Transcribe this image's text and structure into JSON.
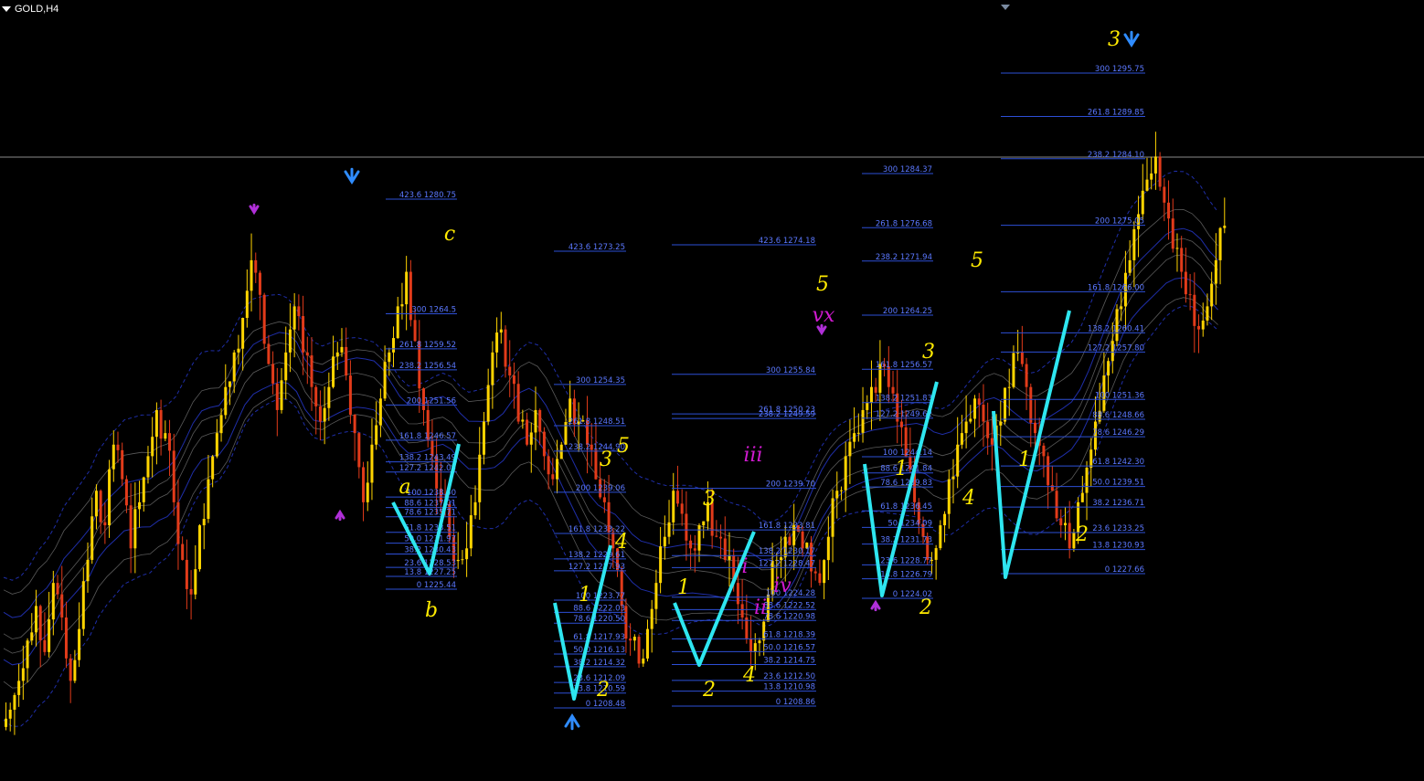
{
  "window": {
    "symbol_title": "GOLD,H4"
  },
  "colors": {
    "background": "#000000",
    "bull_candle": "#ffd400",
    "bear_candle": "#e23b1a",
    "fib_line": "#2d4fd6",
    "fib_text": "#5b78ff",
    "wave_yellow": "#ffea00",
    "wave_magenta": "#d01ad0",
    "pattern_cyan": "#2ee6f0",
    "arrow_blue": "#2f8cff",
    "arrow_purple": "#b02fd8",
    "band_blue": "#1f2ea8",
    "band_gray": "#5a5a5a",
    "hline": "#8a8a8a"
  },
  "chart_data": {
    "type": "candlestick",
    "title": "GOLD,H4",
    "xlabel": "",
    "ylabel": "",
    "grid": false,
    "price_range": [
      1190,
      1320
    ],
    "candles_close_path": [
      1200,
      1205,
      1212,
      1218,
      1210,
      1222,
      1216,
      1205,
      1214,
      1226,
      1238,
      1232,
      1246,
      1240,
      1228,
      1236,
      1244,
      1252,
      1248,
      1236,
      1226,
      1220,
      1232,
      1240,
      1248,
      1256,
      1262,
      1268,
      1278,
      1272,
      1260,
      1252,
      1262,
      1270,
      1262,
      1256,
      1250,
      1256,
      1262,
      1258,
      1248,
      1236,
      1246,
      1254,
      1262,
      1270,
      1276,
      1264,
      1252,
      1244,
      1236,
      1230,
      1226,
      1228,
      1236,
      1250,
      1262,
      1266,
      1258,
      1250,
      1246,
      1252,
      1244,
      1240,
      1246,
      1254,
      1250,
      1246,
      1240,
      1236,
      1228,
      1218,
      1212,
      1208,
      1214,
      1222,
      1230,
      1238,
      1234,
      1228,
      1232,
      1236,
      1230,
      1226,
      1222,
      1216,
      1210,
      1212,
      1220,
      1226,
      1230,
      1232,
      1228,
      1224,
      1222,
      1230,
      1238,
      1244,
      1248,
      1252,
      1256,
      1260,
      1256,
      1250,
      1244,
      1236,
      1230,
      1226,
      1232,
      1240,
      1246,
      1250,
      1254,
      1250,
      1246,
      1250,
      1256,
      1262,
      1256,
      1248,
      1244,
      1238,
      1232,
      1228,
      1236,
      1242,
      1250,
      1258,
      1264,
      1270,
      1278,
      1286,
      1292,
      1296,
      1288,
      1280,
      1276,
      1272,
      1266,
      1270,
      1278,
      1284
    ],
    "fib_sets": [
      {
        "levels": [
          [
            "423.6",
            "1280.75"
          ],
          [
            "300",
            "1264.5"
          ],
          [
            "261.8",
            "1259.52"
          ],
          [
            "238.2",
            "1256.54"
          ],
          [
            "200",
            "1251.56"
          ],
          [
            "161.8",
            "1246.57"
          ],
          [
            "138.2",
            "1243.49"
          ],
          [
            "127.2",
            "1242.05"
          ],
          [
            "100",
            "1238.50"
          ],
          [
            "88.6",
            "1237.01"
          ],
          [
            "78.6",
            "1235.71"
          ],
          [
            "61.8",
            "1233.51"
          ],
          [
            "50.0",
            "1231.97"
          ],
          [
            "38.2",
            "1230.43"
          ],
          [
            "23.6",
            "1228.53"
          ],
          [
            "13.8",
            "1227.25"
          ],
          [
            "0",
            "1225.44"
          ]
        ]
      },
      {
        "levels": [
          [
            "423.6",
            "1273.25"
          ],
          [
            "300",
            "1254.35"
          ],
          [
            "261.8",
            "1248.51"
          ],
          [
            "238.2",
            "1244.90"
          ],
          [
            "200",
            "1239.06"
          ],
          [
            "161.8",
            "1233.22"
          ],
          [
            "138.2",
            "1229.61"
          ],
          [
            "127.2",
            "1227.93"
          ],
          [
            "100",
            "1223.77"
          ],
          [
            "88.6",
            "1222.03"
          ],
          [
            "78.6",
            "1220.50"
          ],
          [
            "61.8",
            "1217.93"
          ],
          [
            "50.0",
            "1216.13"
          ],
          [
            "38.2",
            "1214.32"
          ],
          [
            "23.6",
            "1212.09"
          ],
          [
            "13.8",
            "1210.59"
          ],
          [
            "0",
            "1208.48"
          ]
        ]
      },
      {
        "levels": [
          [
            "423.6",
            "1274.18"
          ],
          [
            "300",
            "1255.84"
          ],
          [
            "261.8",
            "1250.23"
          ],
          [
            "238.2",
            "1249.59"
          ],
          [
            "200",
            "1239.70"
          ],
          [
            "161.8",
            "1233.81"
          ],
          [
            "138.2",
            "1230.17"
          ],
          [
            "127.2",
            "1228.47"
          ],
          [
            "100",
            "1224.28"
          ],
          [
            "88.6",
            "1222.52"
          ],
          [
            "78.6",
            "1220.98"
          ],
          [
            "61.8",
            "1218.39"
          ],
          [
            "50.0",
            "1216.57"
          ],
          [
            "38.2",
            "1214.75"
          ],
          [
            "23.6",
            "1212.50"
          ],
          [
            "13.8",
            "1210.98"
          ],
          [
            "0",
            "1208.86"
          ]
        ]
      },
      {
        "levels": [
          [
            "300",
            "1284.37"
          ],
          [
            "261.8",
            "1276.68"
          ],
          [
            "238.2",
            "1271.94"
          ],
          [
            "200",
            "1264.25"
          ],
          [
            "161.8",
            "1256.57"
          ],
          [
            "138.2",
            "1251.83"
          ],
          [
            "127.2",
            "1249.62"
          ],
          [
            "100",
            "1244.14"
          ],
          [
            "88.6",
            "1241.84"
          ],
          [
            "78.6",
            "1239.83"
          ],
          [
            "61.8",
            "1236.45"
          ],
          [
            "50",
            "1234.09"
          ],
          [
            "38.2",
            "1231.73"
          ],
          [
            "23.6",
            "1228.77"
          ],
          [
            "13.8",
            "1226.79"
          ],
          [
            "0",
            "1224.02"
          ]
        ]
      },
      {
        "levels": [
          [
            "300",
            "1295.75"
          ],
          [
            "261.8",
            "1289.85"
          ],
          [
            "238.2",
            "1284.10"
          ],
          [
            "200",
            "1275.05"
          ],
          [
            "161.8",
            "1266.00"
          ],
          [
            "138.2",
            "1260.41"
          ],
          [
            "127.2",
            "1257.80"
          ],
          [
            "100",
            "1251.36"
          ],
          [
            "88.6",
            "1248.66"
          ],
          [
            "78.6",
            "1246.29"
          ],
          [
            "61.8",
            "1242.30"
          ],
          [
            "50.0",
            "1239.51"
          ],
          [
            "38.2",
            "1236.71"
          ],
          [
            "23.6",
            "1233.25"
          ],
          [
            "13.8",
            "1230.93"
          ],
          [
            "0",
            "1227.66"
          ]
        ]
      }
    ],
    "wave_labels": [
      {
        "text": "a",
        "color": "wave_yellow"
      },
      {
        "text": "b",
        "color": "wave_yellow"
      },
      {
        "text": "c",
        "color": "wave_yellow"
      },
      {
        "text": "1",
        "color": "wave_yellow"
      },
      {
        "text": "2",
        "color": "wave_yellow"
      },
      {
        "text": "3",
        "color": "wave_yellow"
      },
      {
        "text": "4",
        "color": "wave_yellow"
      },
      {
        "text": "5",
        "color": "wave_yellow"
      },
      {
        "text": "1",
        "color": "wave_yellow"
      },
      {
        "text": "2",
        "color": "wave_yellow"
      },
      {
        "text": "3",
        "color": "wave_yellow"
      },
      {
        "text": "4",
        "color": "wave_yellow"
      },
      {
        "text": "5",
        "color": "wave_yellow"
      },
      {
        "text": "i",
        "color": "wave_magenta"
      },
      {
        "text": "ii",
        "color": "wave_magenta"
      },
      {
        "text": "iii",
        "color": "wave_magenta"
      },
      {
        "text": "iv",
        "color": "wave_magenta"
      },
      {
        "text": "vx",
        "color": "wave_magenta"
      },
      {
        "text": "1",
        "color": "wave_yellow"
      },
      {
        "text": "2",
        "color": "wave_yellow"
      },
      {
        "text": "3",
        "color": "wave_yellow"
      },
      {
        "text": "4",
        "color": "wave_yellow"
      },
      {
        "text": "5",
        "color": "wave_yellow"
      },
      {
        "text": "1",
        "color": "wave_yellow"
      },
      {
        "text": "2",
        "color": "wave_yellow"
      },
      {
        "text": "3",
        "color": "wave_yellow"
      }
    ]
  }
}
